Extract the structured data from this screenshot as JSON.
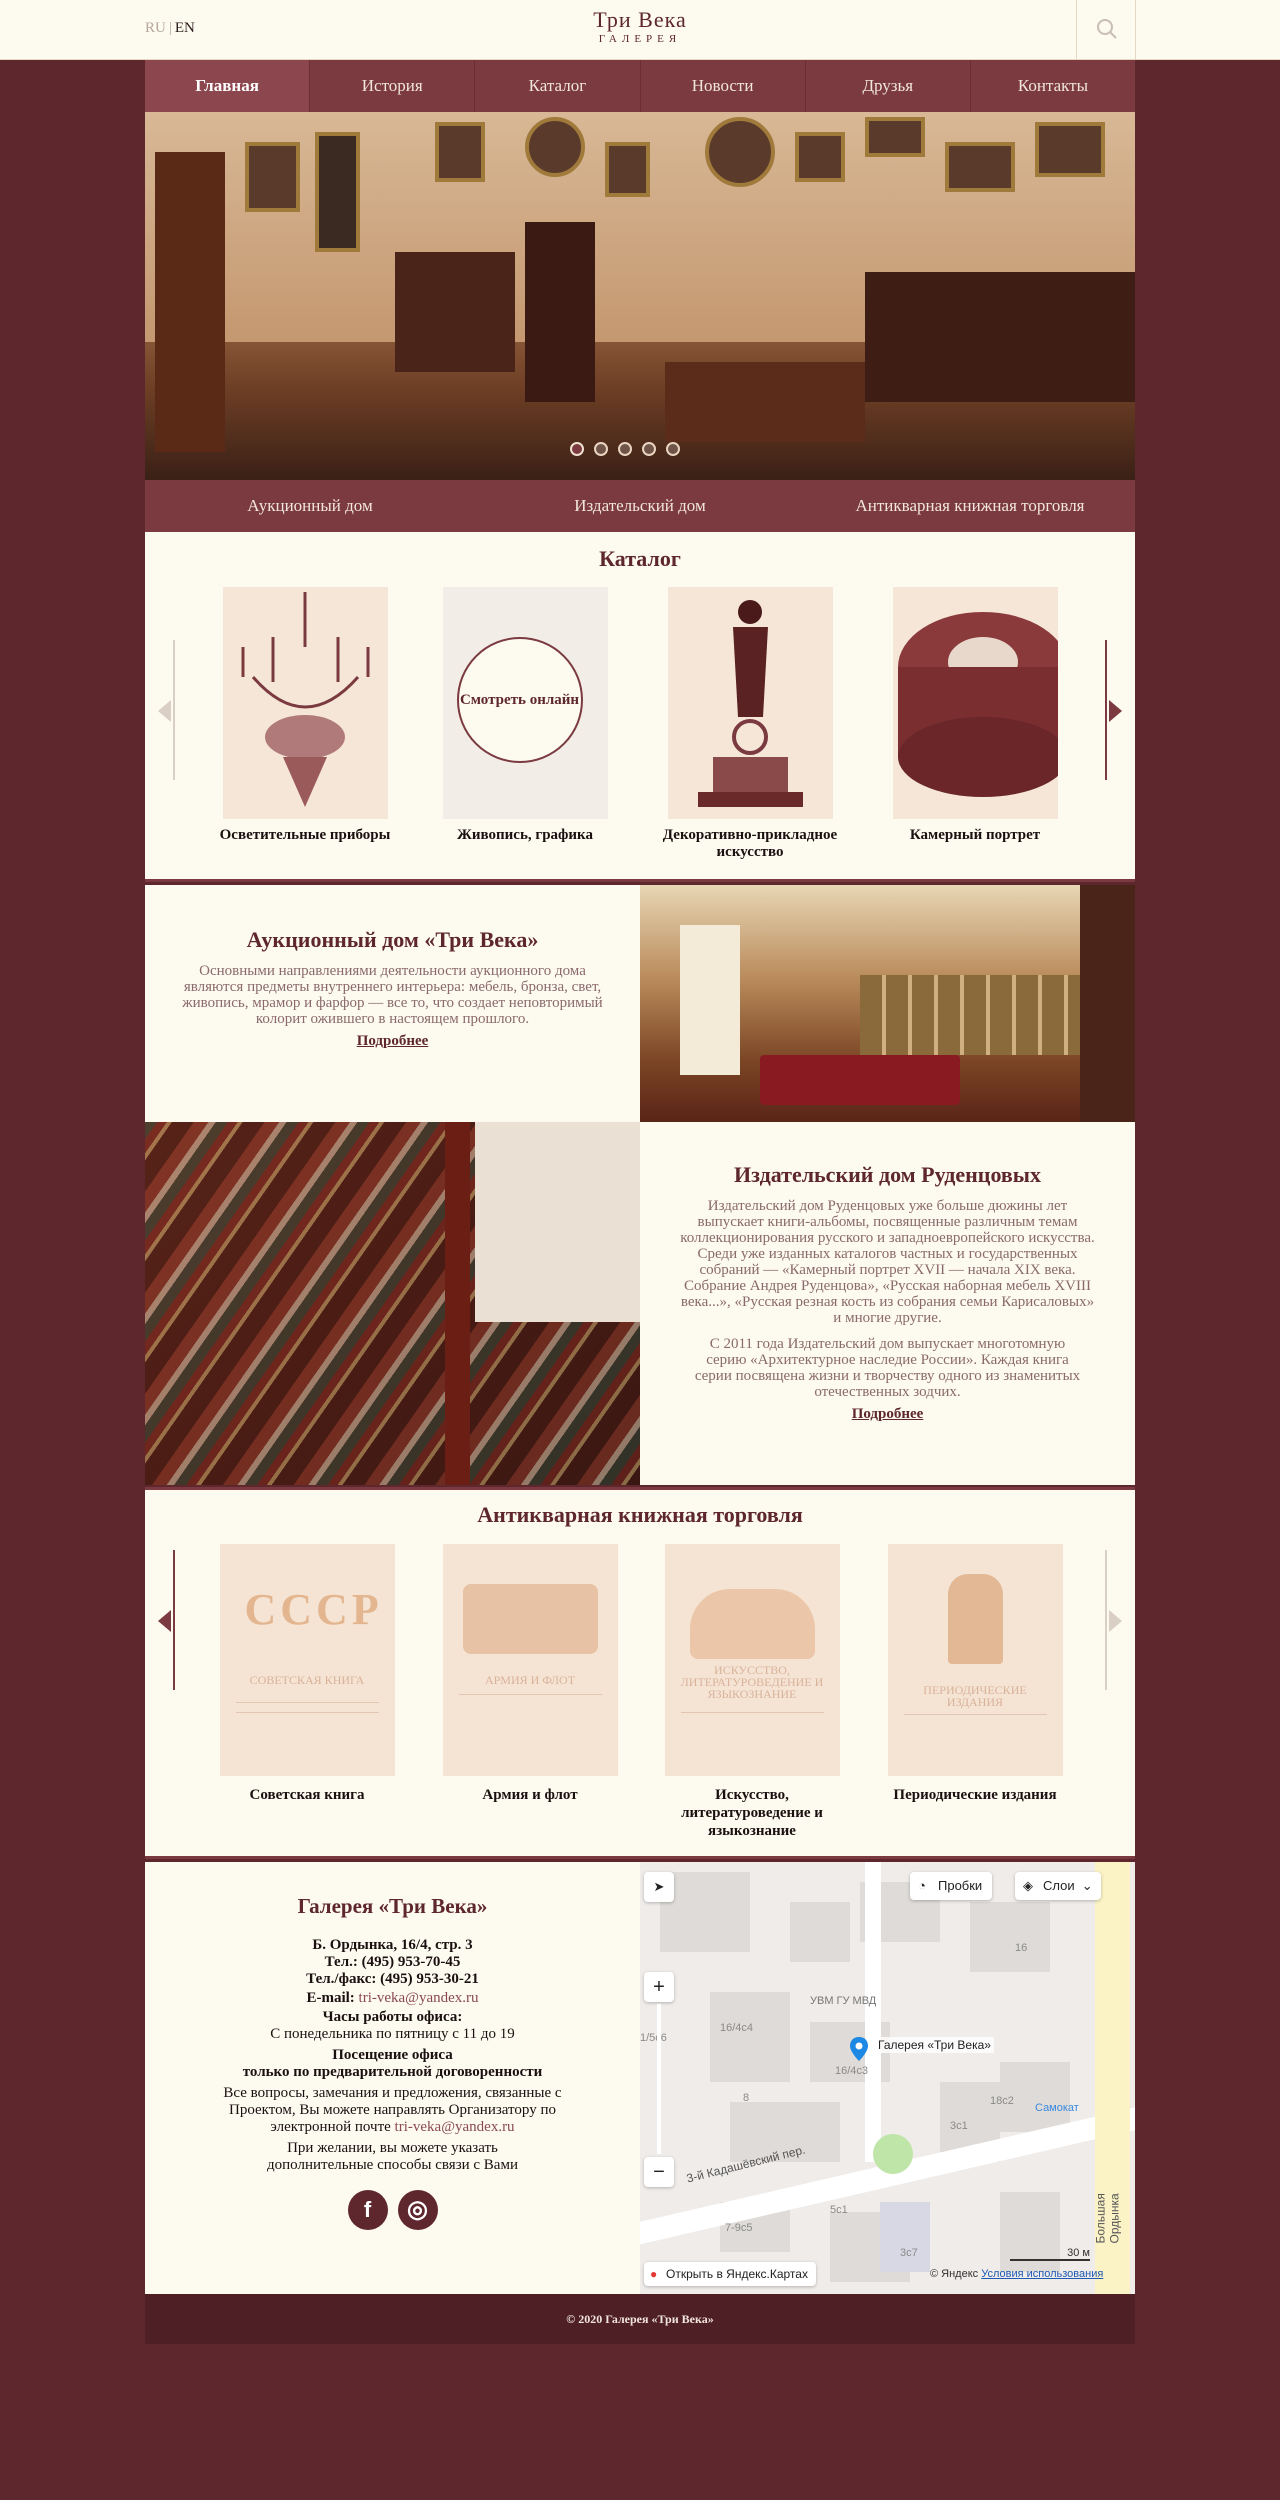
{
  "header": {
    "lang_ru": "RU",
    "lang_sep": "|",
    "lang_en": "EN",
    "logo_line1": "Три Века",
    "logo_line2": "ГАЛЕРЕЯ",
    "search_icon": "search-icon"
  },
  "nav": [
    "Главная",
    "История",
    "Каталог",
    "Новости",
    "Друзья",
    "Контакты"
  ],
  "subnav": [
    "Аукционный дом",
    "Издательский дом",
    "Антикварная книжная торговля"
  ],
  "catalog": {
    "title": "Каталог",
    "online_label": "Смотреть онлайн",
    "items": [
      {
        "name": "Осветительные приборы"
      },
      {
        "name": "Живопись, графика"
      },
      {
        "name": "Декоративно-прикладное искусство"
      },
      {
        "name": "Камерный портрет"
      }
    ]
  },
  "auction": {
    "title": "Аукционный дом «Три Века»",
    "text": "Основными направлениями деятельности аукционного дома являются предметы внутреннего интерьера: мебель, бронза, свет, живопись, мрамор и фарфор — все то, что создает неповторимый колорит ожившего в настоящем прошлого.",
    "more": "Подробнее"
  },
  "publishing": {
    "title": "Издательский дом Руденцовых",
    "text1": "Издательский дом Руденцовых уже больше дюжины лет выпускает книги-альбомы, посвященные различным темам коллекционирования русского и западноевропейского искусства. Среди уже изданных каталогов частных и государственных собраний — «Камерный портрет XVII — начала XIX века. Собрание Андрея Руденцова», «Русская наборная мебель XVIII века...», «Русская резная кость из собрания семьи Карисаловых» и многие другие.",
    "text2": "С 2011 года Издательский дом выпускает многотомную серию «Архитектурное наследие России». Каждая книга серии посвящена жизни и творчеству одного из знаменитых отечественных зодчих.",
    "more": "Подробнее"
  },
  "books": {
    "title": "Антикварная книжная торговля",
    "items": [
      {
        "name": "Советская книга",
        "cover": "Советская книга"
      },
      {
        "name": "Армия и флот",
        "cover": "Армия и флот"
      },
      {
        "name": "Искусство, литературоведение и языкознание",
        "cover": "Искусство, литературоведение и языкознание"
      },
      {
        "name": "Периодические издания",
        "cover": "Периодические издания"
      }
    ]
  },
  "contacts": {
    "title": "Галерея «Три Века»",
    "address": "Б. Ордынка, 16/4, стр. 3",
    "phone": "Тел.: (495) 953-70-45",
    "fax": "Тел./факс: (495) 953-30-21",
    "email_label": "E-mail: ",
    "email": "tri-veka@yandex.ru",
    "hours_title": "Часы работы офиса:",
    "hours": "С понедельника по пятницу с 11 до 19",
    "visit_title": "Посещение офиса",
    "visit_note": "только по предварительной договоренности",
    "feedback": "Все вопросы, замечания и предложения, связанные с Проектом, Вы можете направлять Организатору по электронной почте ",
    "feedback_email": "tri-veka@yandex.ru",
    "extra": "При желании, вы можете указать дополнительные способы связи с Вами",
    "social": [
      {
        "icon": "facebook-icon",
        "glyph": "f"
      },
      {
        "icon": "instagram-icon",
        "glyph": "◎"
      }
    ]
  },
  "map": {
    "traffic": "Пробки",
    "layers": "Слои",
    "marker_label": "Галерея «Три Века»",
    "street": "3-й Кадашёвский пер.",
    "street2": "Большая Ордынка",
    "police": "УВМ ГУ МВД",
    "samokat": "Самокат",
    "open_link": "Открыть в Яндекс.Картах",
    "copyright": "© Яндекс",
    "terms": "Условия использования",
    "scale": "30 м",
    "labels": [
      "16",
      "16/4с4",
      "16/4с3",
      "8",
      "7-9с5",
      "5с1",
      "3с7",
      "3с1",
      "18с2",
      "1/5с6"
    ]
  },
  "footer": {
    "text": "© 2020 Галерея «Три Века»"
  }
}
